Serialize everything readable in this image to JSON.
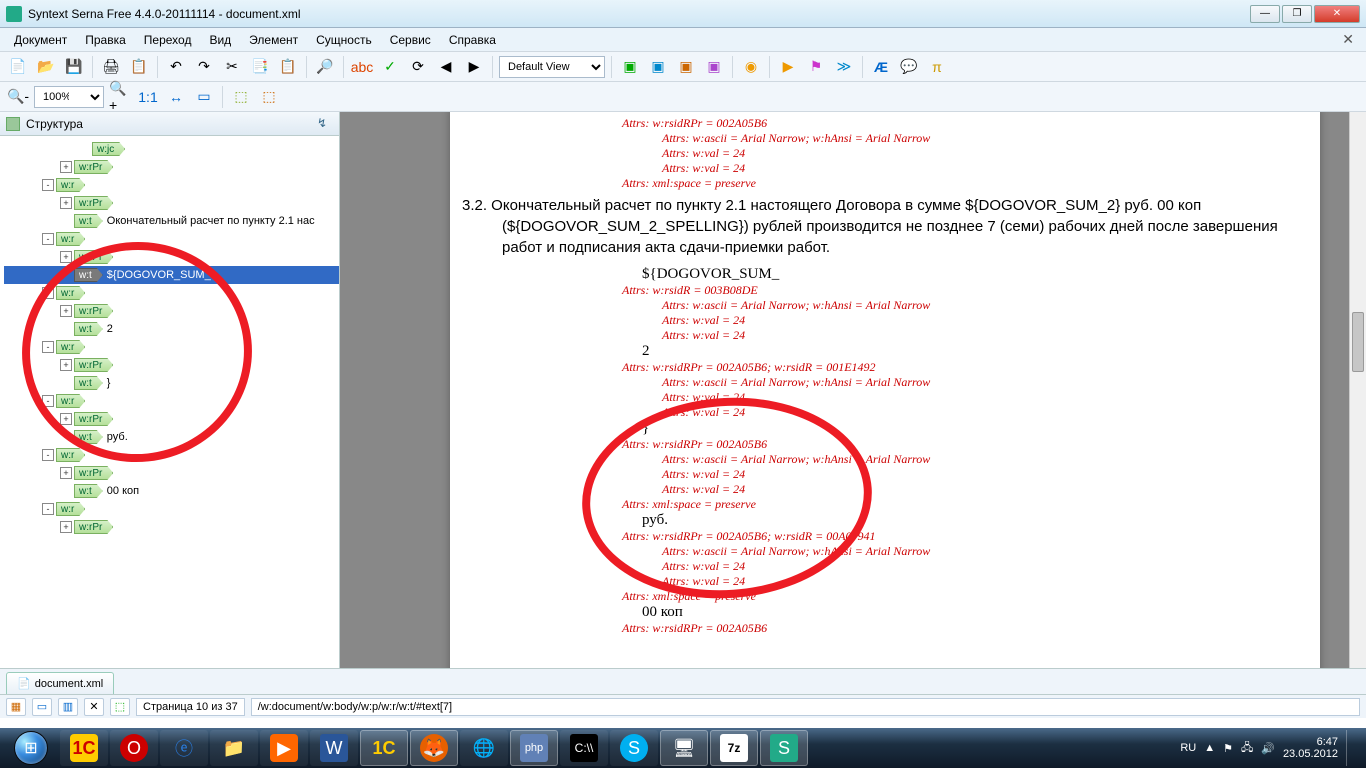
{
  "title": "Syntext Serna Free 4.4.0-20111114 - document.xml",
  "menu": [
    "Документ",
    "Правка",
    "Переход",
    "Вид",
    "Элемент",
    "Сущность",
    "Сервис",
    "Справка"
  ],
  "view_select": "Default View",
  "zoom": "100%",
  "panel_title": "Структура",
  "tree": [
    {
      "ind": 3,
      "exp": "",
      "tag": "w:jc",
      "txt": ""
    },
    {
      "ind": 2,
      "exp": "+",
      "tag": "w:rPr",
      "txt": ""
    },
    {
      "ind": 1,
      "exp": "-",
      "tag": "w:r",
      "txt": ""
    },
    {
      "ind": 2,
      "exp": "+",
      "tag": "w:rPr",
      "txt": ""
    },
    {
      "ind": 2,
      "exp": "",
      "tag": "w:t",
      "txt": "Окончательный расчет по пункту 2.1 нас"
    },
    {
      "ind": 1,
      "exp": "-",
      "tag": "w:r",
      "txt": "",
      "sel": false
    },
    {
      "ind": 2,
      "exp": "+",
      "tag": "w:rPr",
      "txt": ""
    },
    {
      "ind": 2,
      "exp": "",
      "tag": "w:t",
      "txt": "${DOGOVOR_SUM_",
      "sel": true
    },
    {
      "ind": 1,
      "exp": "-",
      "tag": "w:r",
      "txt": ""
    },
    {
      "ind": 2,
      "exp": "+",
      "tag": "w:rPr",
      "txt": ""
    },
    {
      "ind": 2,
      "exp": "",
      "tag": "w:t",
      "txt": "2"
    },
    {
      "ind": 1,
      "exp": "-",
      "tag": "w:r",
      "txt": ""
    },
    {
      "ind": 2,
      "exp": "+",
      "tag": "w:rPr",
      "txt": ""
    },
    {
      "ind": 2,
      "exp": "",
      "tag": "w:t",
      "txt": "}"
    },
    {
      "ind": 1,
      "exp": "-",
      "tag": "w:r",
      "txt": ""
    },
    {
      "ind": 2,
      "exp": "+",
      "tag": "w:rPr",
      "txt": ""
    },
    {
      "ind": 2,
      "exp": "",
      "tag": "w:t",
      "txt": "руб."
    },
    {
      "ind": 1,
      "exp": "-",
      "tag": "w:r",
      "txt": ""
    },
    {
      "ind": 2,
      "exp": "+",
      "tag": "w:rPr",
      "txt": ""
    },
    {
      "ind": 2,
      "exp": "",
      "tag": "w:t",
      "txt": "00 коп"
    },
    {
      "ind": 1,
      "exp": "-",
      "tag": "w:r",
      "txt": ""
    },
    {
      "ind": 2,
      "exp": "+",
      "tag": "w:rPr",
      "txt": ""
    }
  ],
  "doc": {
    "top_attr1": "Attrs:   w:rsidRPr = 002A05B6",
    "top_attr2": "Attrs:   w:ascii = Arial Narrow; w:hAnsi = Arial Narrow",
    "top_attr3": "Attrs:   w:val = 24",
    "top_attr4": "Attrs:   w:val = 24",
    "top_attr5": "Attrs:   xml:space = preserve",
    "para": "3.2. Окончательный расчет по пункту 2.1 настоящего Договора в сумме ${DOGOVOR_SUM_2} руб. 00 коп (${DOGOVOR_SUM_2_SPELLING}) рублей производится не позднее 7 (семи) рабочих дней после завершения работ и подписания акта сдачи-приемки работ.",
    "frag1": "${DOGOVOR_SUM_",
    "a1": "Attrs:   w:rsidR = 003B08DE",
    "a2": "Attrs:   w:ascii = Arial Narrow; w:hAnsi = Arial Narrow",
    "a3": "Attrs:   w:val = 24",
    "a4": "Attrs:   w:val = 24",
    "frag2": "2",
    "b1": "Attrs:   w:rsidRPr = 002A05B6; w:rsidR = 001E1492",
    "b2": "Attrs:   w:ascii = Arial Narrow; w:hAnsi = Arial Narrow",
    "b3": "Attrs:   w:val = 24",
    "b4": "Attrs:   w:val = 24",
    "frag3": "}",
    "c1": "Attrs:   w:rsidRPr = 002A05B6",
    "c2": "Attrs:   w:ascii = Arial Narrow; w:hAnsi = Arial Narrow",
    "c3": "Attrs:   w:val = 24",
    "c4": "Attrs:   w:val = 24",
    "c5": "Attrs:   xml:space = preserve",
    "frag4": "руб.",
    "d1": "Attrs:   w:rsidRPr = 002A05B6; w:rsidR = 00A07941",
    "d2": "Attrs:   w:ascii = Arial Narrow; w:hAnsi = Arial Narrow",
    "d3": "Attrs:   w:val = 24",
    "d4": "Attrs:   w:val = 24",
    "d5": "Attrs:   xml:space = preserve",
    "frag5": "00 коп",
    "e1": "Attrs:   w:rsidRPr = 002A05B6"
  },
  "filetab": "document.xml",
  "status_page": "Страница 10 из 37",
  "status_path": "/w:document/w:body/w:p/w:r/w:t/#text[7]",
  "tray_lang": "RU",
  "tray_time": "6:47",
  "tray_date": "23.05.2012",
  "toolbar_icons": [
    "📄",
    "📂",
    "💾",
    "🖨",
    "📋",
    "↶",
    "↷",
    "✂",
    "📑",
    "📋",
    "🔍",
    "🎨",
    "✓",
    "⟳",
    "◀",
    "▶"
  ],
  "toolbar2": [
    "▶",
    "⏸",
    "➤",
    "Æ",
    "💬",
    "🔔"
  ]
}
